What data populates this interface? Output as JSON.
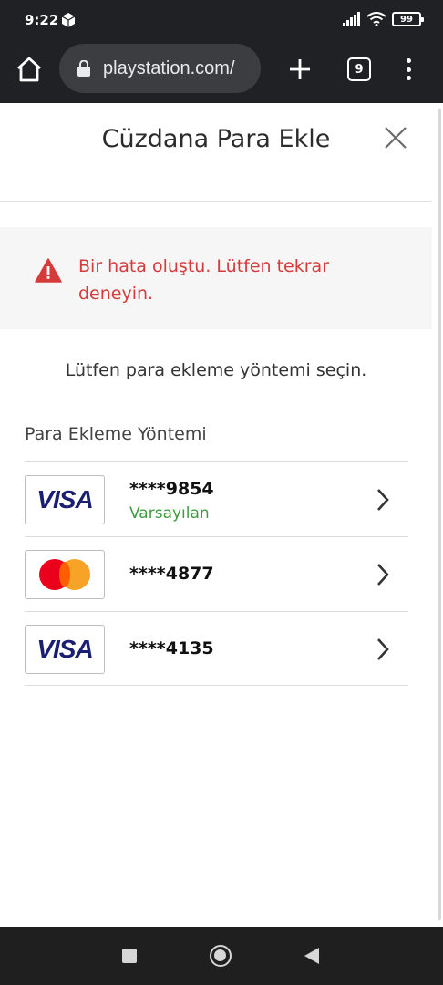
{
  "status_bar": {
    "time": "9:22",
    "battery": "99"
  },
  "browser": {
    "url": "playstation.com/",
    "tab_count": "9"
  },
  "dialog": {
    "title": "Cüzdana Para Ekle"
  },
  "error": {
    "message": "Bir hata oluştu. Lütfen tekrar deneyin.",
    "color": "#d53b3b"
  },
  "instruction": "Lütfen para ekleme yöntemi seçin.",
  "section_label": "Para Ekleme Yöntemi",
  "payment_methods": [
    {
      "brand": "VISA",
      "icon": "visa-logo",
      "number": "****9854",
      "badge": "Varsayılan"
    },
    {
      "brand": "mastercard",
      "icon": "mastercard-logo",
      "number": "****4877"
    },
    {
      "brand": "VISA",
      "icon": "visa-logo",
      "number": "****4135"
    }
  ],
  "colors": {
    "default_badge": "#3e9b3e",
    "visa_blue": "#1a1f71"
  }
}
